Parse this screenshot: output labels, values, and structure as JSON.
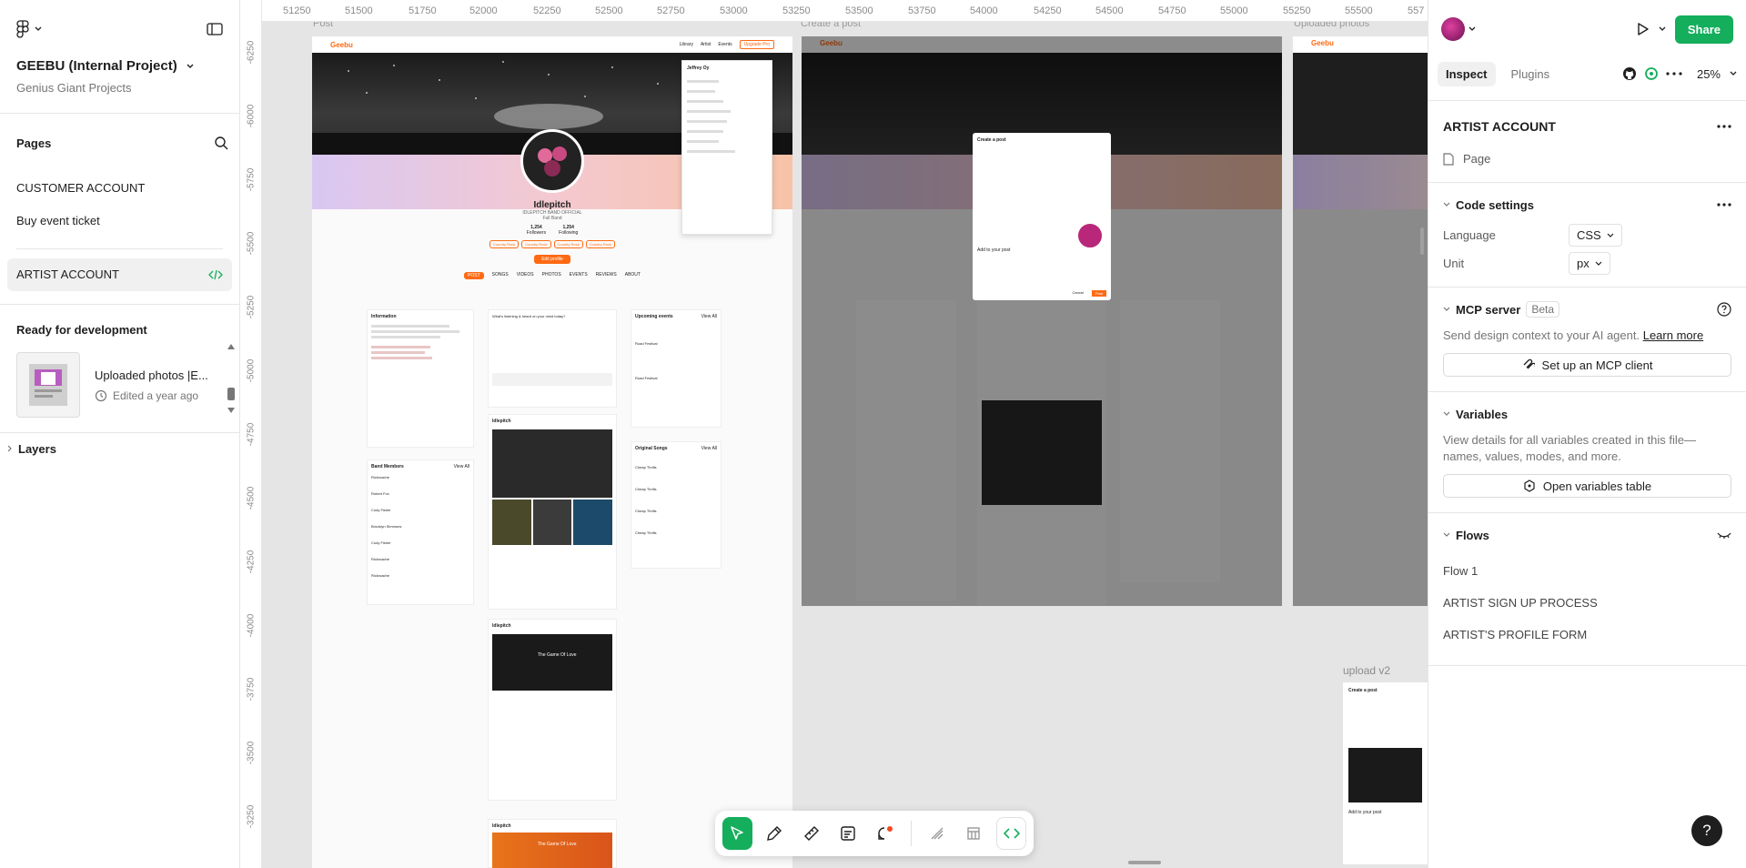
{
  "project": {
    "name": "GEEBU (Internal Project)",
    "team": "Genius Giant Projects"
  },
  "pages": {
    "title": "Pages",
    "items": [
      "CUSTOMER ACCOUNT",
      "Buy event ticket"
    ],
    "selected": "ARTIST ACCOUNT"
  },
  "ready": {
    "title": "Ready for development",
    "item_title": "Uploaded photos |E...",
    "item_sub": "Edited a year ago"
  },
  "layers": {
    "title": "Layers"
  },
  "ruler": {
    "x": [
      "51250",
      "51500",
      "51750",
      "52000",
      "52250",
      "52500",
      "52750",
      "53000",
      "53250",
      "53500",
      "53750",
      "54000",
      "54250",
      "54500",
      "54750",
      "55000",
      "55250",
      "55500",
      "557"
    ],
    "y": [
      "-6250",
      "-6000",
      "-5750",
      "-5500",
      "-5250",
      "-5000",
      "-4750",
      "-4500",
      "-4250",
      "-4000",
      "-3750",
      "-3500",
      "-3250"
    ]
  },
  "frames": {
    "post": "Post",
    "create": "Create a post",
    "uploaded": "Uploaded photos",
    "upload_v2": "upload v2"
  },
  "mock": {
    "logo": "Geebu",
    "nav": [
      "Library",
      "Artist",
      "Events"
    ],
    "upgrade": "Upgrade Pro",
    "artist_name": "Idlepitch",
    "artist_handle": "IDLEPITCH BAND OFFICIAL",
    "artist_role": "Full Band",
    "followers": "1,254",
    "followers_label": "Followers",
    "following": "1,254",
    "following_label": "Following",
    "genres": [
      "Country Rock",
      "Country Rock",
      "Country Rock",
      "Country Rock"
    ],
    "edit_profile": "Edit profile",
    "tabs": [
      "POST",
      "SONGS",
      "VIDEOS",
      "PHOTOS",
      "EVENTS",
      "REVIEWS",
      "ABOUT"
    ],
    "info_title": "Information",
    "band_title": "Band Members",
    "upcoming_title": "Upcoming events",
    "original_title": "Original Songs",
    "view_all": "View All",
    "compose": "What's listening & heard on your mind today?",
    "post_name": "Idlepitch",
    "song_title": "The Game Of Love",
    "create_post": "Create a post",
    "add_to_post": "Add to your post",
    "cancel": "Cancel",
    "post": "Post",
    "members": [
      "Rickroache",
      "Robert Fox",
      "Cody Fisher",
      "Brooklyn Simmons",
      "Cody Fisher",
      "Rickroache",
      "Rickroache"
    ],
    "events": [
      "Road Festival",
      "Road Festival",
      "Road Festival"
    ],
    "songs": [
      "Cheap Thrills",
      "Cheap Thrills",
      "Cheap Thrills",
      "Cheap Thrills",
      "Cheap Thrills"
    ],
    "menu_user": "Jeffrey Oy"
  },
  "right": {
    "zoom": "25%",
    "tabs": [
      "Inspect",
      "Plugins"
    ],
    "share": "Share",
    "page_title": "ARTIST ACCOUNT",
    "page_type": "Page",
    "code_settings": "Code settings",
    "language_label": "Language",
    "language": "CSS",
    "unit_label": "Unit",
    "unit": "px",
    "mcp_title": "MCP server",
    "mcp_badge": "Beta",
    "mcp_desc": "Send design context to your AI agent.",
    "mcp_link": "Learn more",
    "mcp_button": "Set up an MCP client",
    "vars_title": "Variables",
    "vars_desc": "View details for all variables created in this file—names, values, modes, and more.",
    "vars_button": "Open variables table",
    "flows_title": "Flows",
    "flows": [
      "Flow 1",
      "ARTIST SIGN UP PROCESS",
      "ARTIST'S PROFILE FORM"
    ]
  },
  "colors": {
    "accent": "#14ae5c",
    "brand": "#ff6a13",
    "dark": "#1e1e1e"
  }
}
